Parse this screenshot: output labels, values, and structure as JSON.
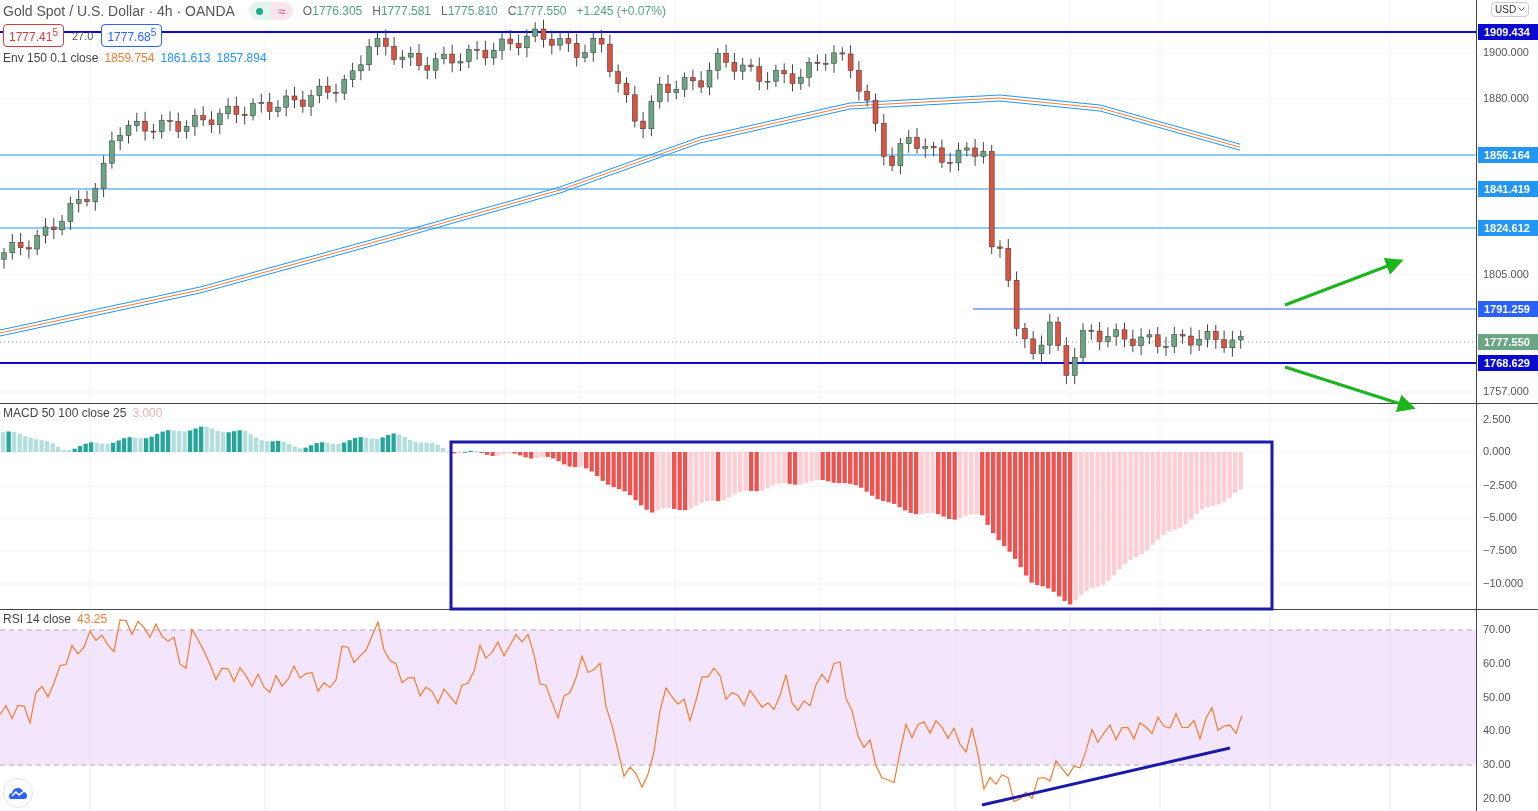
{
  "header": {
    "title": "Gold Spot / U.S. Dollar · 4h · OANDA",
    "delay_badge": "≈",
    "ohlc": [
      {
        "label": "O",
        "value": "1776.305"
      },
      {
        "label": "H",
        "value": "1777.581"
      },
      {
        "label": "L",
        "value": "1775.810"
      },
      {
        "label": "C",
        "value": "1777.550"
      }
    ],
    "change": "+1.245 (+0.07%)"
  },
  "quote": {
    "bid": "1777.41$^{5}$",
    "spread": "27.0",
    "ask": "1777.68$^{5}$"
  },
  "envelope": {
    "name": "Env 150 0.1 close",
    "values": [
      {
        "value": "1859.754",
        "color": "#f57c30"
      },
      {
        "value": "1861.613",
        "color": "#2196f3"
      },
      {
        "value": "1857.894",
        "color": "#2196f3"
      }
    ]
  },
  "price_axis": {
    "currency": "USD",
    "ticks": [
      "1900.000",
      "1880.000",
      "1805.000",
      "1757.000"
    ],
    "levels": [
      {
        "label": "1909.434",
        "color": "#0a0acf",
        "kind": "major"
      },
      {
        "label": "1856.164",
        "color": "#2196f3",
        "kind": "minor"
      },
      {
        "label": "1841.419",
        "color": "#2196f3",
        "kind": "minor"
      },
      {
        "label": "1824.612",
        "color": "#2196f3",
        "kind": "minor"
      },
      {
        "label": "1791.259",
        "color": "#2962ff",
        "kind": "short"
      },
      {
        "label": "1768.629",
        "color": "#0a0acf",
        "kind": "major"
      }
    ],
    "last_price": {
      "label": "1777.550",
      "color": "#6ba583"
    }
  },
  "macd": {
    "name": "MACD 50 100 close 25",
    "value": "3.000",
    "ticks": [
      "2.500",
      "0.000",
      "−2.500",
      "−5.000",
      "−7.500",
      "−10.000"
    ]
  },
  "rsi": {
    "name": "RSI 14 close",
    "value": "43.25",
    "ticks": [
      "70.00",
      "60.00",
      "50.00",
      "40.00",
      "30.00",
      "20.00"
    ]
  }
}
